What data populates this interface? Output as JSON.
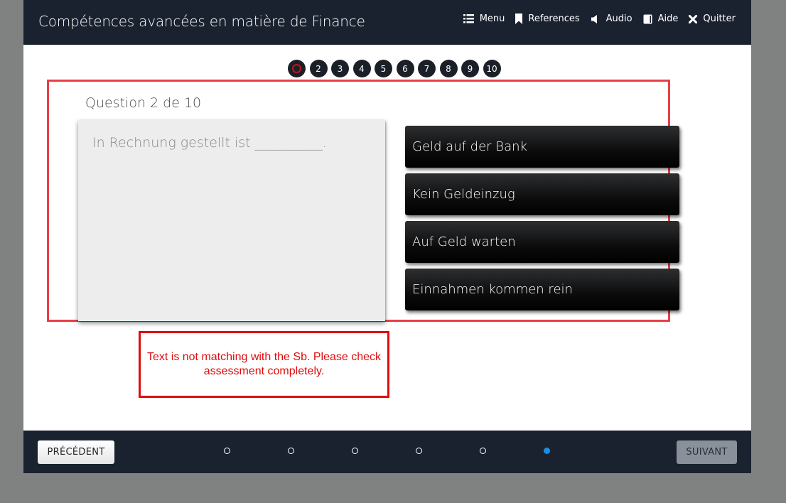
{
  "header": {
    "title": "Compétences avancées en matière de Finance",
    "nav": [
      {
        "label": "Menu",
        "icon": "list-icon"
      },
      {
        "label": "References",
        "icon": "bookmark-icon"
      },
      {
        "label": "Audio",
        "icon": "speaker-icon"
      },
      {
        "label": "Aide",
        "icon": "book-icon"
      },
      {
        "label": "Quitter",
        "icon": "close-icon"
      }
    ]
  },
  "question_nav": {
    "current_index": 1,
    "items": [
      "2",
      "3",
      "4",
      "5",
      "6",
      "7",
      "8",
      "9",
      "10"
    ]
  },
  "question": {
    "title": "Question 2 de 10",
    "prompt": "In Rechnung gestellt ist __________.",
    "answers": [
      "Geld auf der Bank",
      "Kein Geldeinzug",
      "Auf Geld warten",
      "Einnahmen kommen rein"
    ]
  },
  "review_note": "Text is not matching with the Sb. Please check assessment completely.",
  "footer": {
    "prev_label": "PRÉCÉDENT",
    "next_label": "SUIVANT",
    "page_count": 6,
    "active_page": 6
  },
  "colors": {
    "header_bg": "#1a2230",
    "highlight": "#e83f45",
    "note": "#e00b0b",
    "active_dot": "#1e8de0"
  }
}
